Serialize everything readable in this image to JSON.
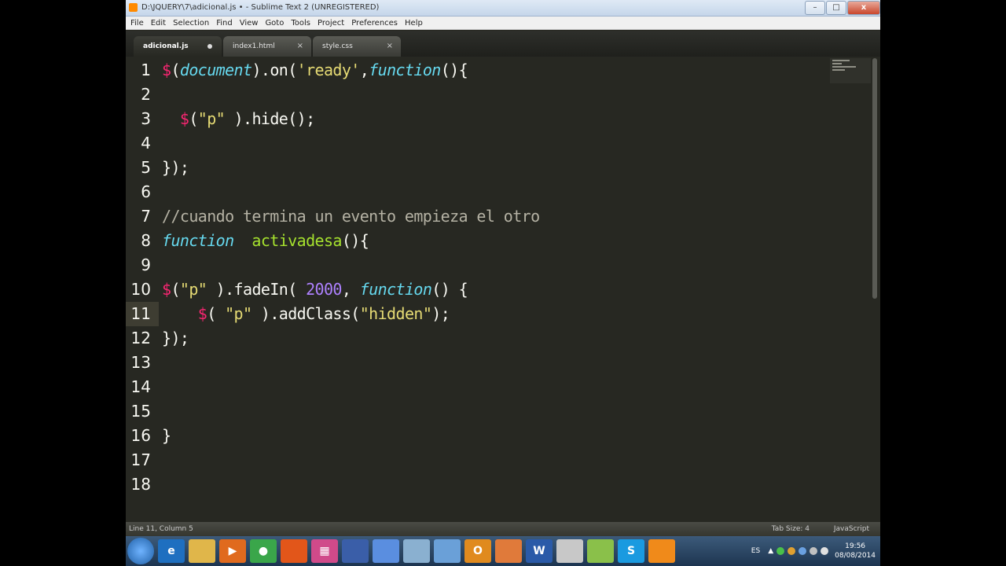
{
  "window": {
    "title": "D:\\JQUERY\\7\\adicional.js • - Sublime Text 2 (UNREGISTERED)",
    "controls": [
      "–",
      "□",
      "x"
    ]
  },
  "menu": [
    "File",
    "Edit",
    "Selection",
    "Find",
    "View",
    "Goto",
    "Tools",
    "Project",
    "Preferences",
    "Help"
  ],
  "tabs": [
    {
      "label": "adicional.js",
      "active": true,
      "dirty": true
    },
    {
      "label": "index1.html",
      "close": "×"
    },
    {
      "label": "style.css",
      "close": "×"
    }
  ],
  "editor": {
    "current_line": 11,
    "line_numbers": [
      "1",
      "2",
      "3",
      "4",
      "5",
      "6",
      "7",
      "8",
      "9",
      "10",
      "11",
      "12",
      "13",
      "14",
      "15",
      "16",
      "17",
      "18"
    ]
  },
  "statusbar": {
    "left": "Line 11, Column 5",
    "tab_size": "Tab Size: 4",
    "syntax": "JavaScript"
  },
  "taskbar": {
    "lang": "ES",
    "time": "19:56",
    "date": "08/08/2014"
  }
}
